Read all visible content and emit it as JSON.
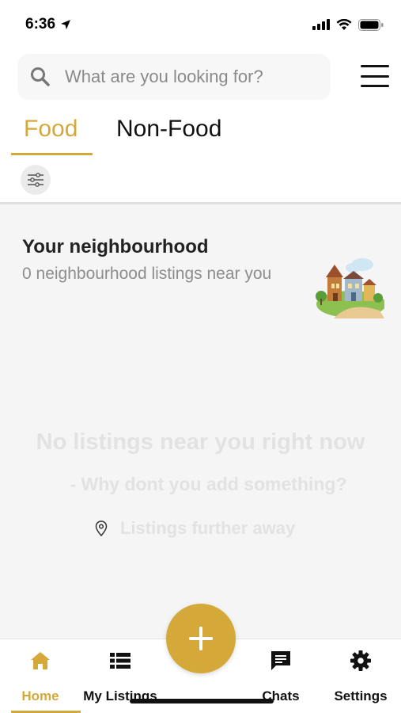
{
  "status_bar": {
    "time": "6:36"
  },
  "search": {
    "placeholder": "What are you looking for?"
  },
  "tabs": [
    {
      "label": "Food",
      "active": true
    },
    {
      "label": "Non-Food",
      "active": false
    }
  ],
  "neighbourhood": {
    "title": "Your neighbourhood",
    "subtitle": "0 neighbourhood listings near you"
  },
  "empty_state": {
    "title": "No listings near you right now",
    "subtitle": "- Why dont you add something?",
    "further_label": "Listings further away"
  },
  "bottom_nav": [
    {
      "label": "Home",
      "icon": "home-icon",
      "active": true
    },
    {
      "label": "My Listings",
      "icon": "list-icon",
      "active": false
    },
    {
      "label": "Chats",
      "icon": "chat-icon",
      "active": false
    },
    {
      "label": "Settings",
      "icon": "gear-icon",
      "active": false
    }
  ],
  "colors": {
    "accent": "#d4a93a",
    "content_bg": "#f5f5f5",
    "muted_text": "#8d8d8d",
    "empty_text": "#e2e2e2"
  }
}
